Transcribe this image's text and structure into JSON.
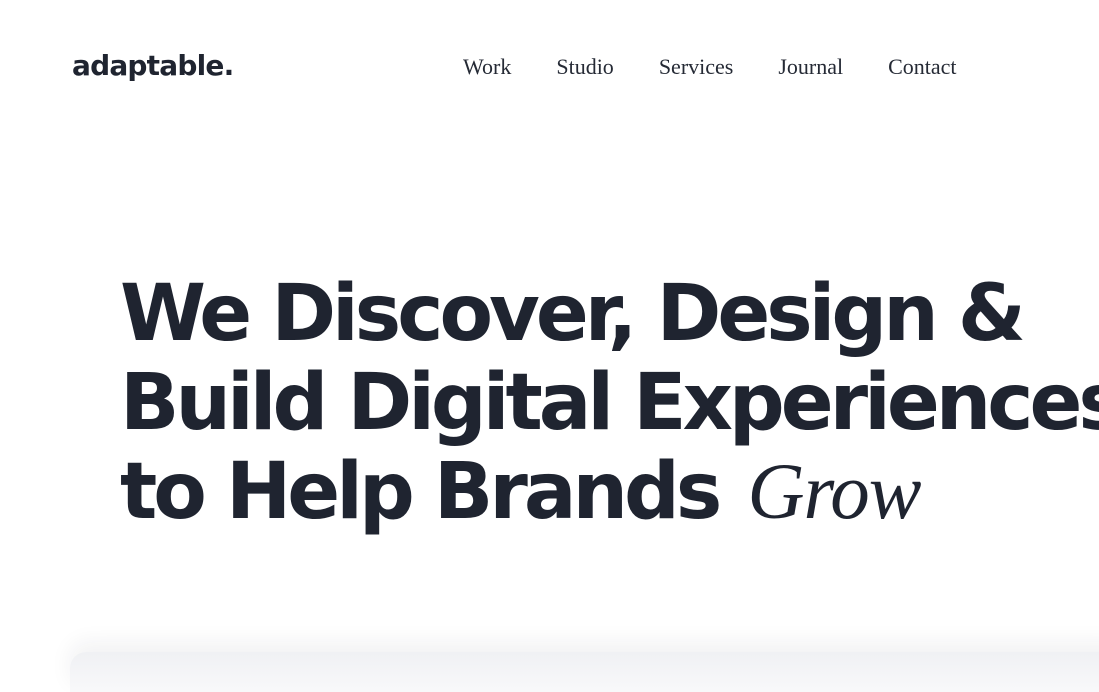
{
  "brand": {
    "name": "adaptable."
  },
  "nav": {
    "items": [
      "Work",
      "Studio",
      "Services",
      "Journal",
      "Contact"
    ]
  },
  "hero": {
    "line_1": "We Discover, Design &",
    "line_2": "Build Digital Experiences",
    "line_3_main": "to Help Brands",
    "line_3_accent": "Grow"
  }
}
